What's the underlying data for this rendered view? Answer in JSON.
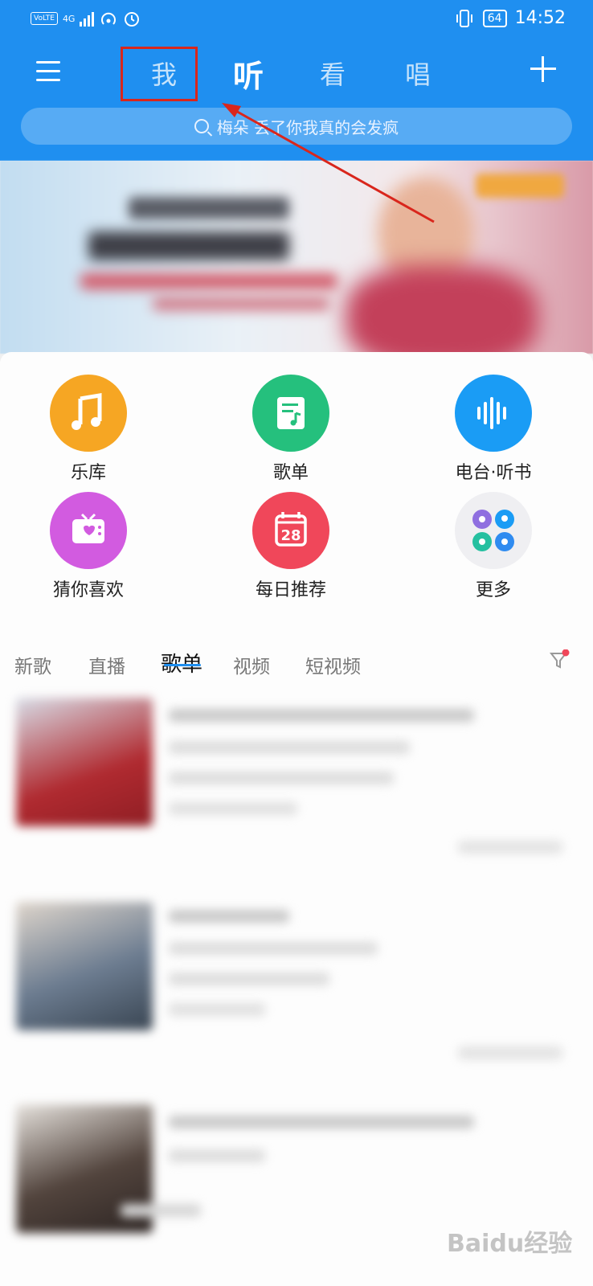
{
  "status_bar": {
    "volte": "VoLTE",
    "network": "4G",
    "battery": "64",
    "time": "14:52"
  },
  "header": {
    "tabs": [
      {
        "label": "我"
      },
      {
        "label": "听"
      },
      {
        "label": "看"
      },
      {
        "label": "唱"
      }
    ],
    "active_tab": "听"
  },
  "search": {
    "placeholder": "梅朵 丢了你我真的会发疯"
  },
  "shortcuts": [
    {
      "label": "乐库",
      "icon": "music-note-icon",
      "color": "#f6a623"
    },
    {
      "label": "歌单",
      "icon": "playlist-icon",
      "color": "#25c07d"
    },
    {
      "label": "电台·听书",
      "icon": "soundwave-icon",
      "color": "#1a9cf5"
    },
    {
      "label": "猜你喜欢",
      "icon": "radio-heart-icon",
      "color": "#d25be0"
    },
    {
      "label": "每日推荐",
      "icon": "calendar-icon",
      "color": "#f0475a",
      "day": "28"
    },
    {
      "label": "更多",
      "icon": "more-grid-icon",
      "color": "#f2f2f2"
    }
  ],
  "content_tabs": [
    {
      "label": "新歌"
    },
    {
      "label": "直播"
    },
    {
      "label": "歌单"
    },
    {
      "label": "视频"
    },
    {
      "label": "短视频"
    }
  ],
  "active_content_tab": "歌单",
  "colors": {
    "brand_blue": "#1f8ff0",
    "highlight_red": "#d9261c"
  },
  "watermark": "Baidu经验"
}
